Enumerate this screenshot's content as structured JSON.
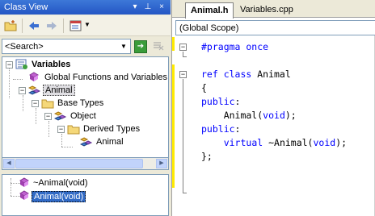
{
  "class_view": {
    "title": "Class View",
    "title_buttons": [
      "▾",
      "⊥",
      "×"
    ],
    "search": {
      "placeholder": "<Search>",
      "value": "<Search>"
    },
    "tree": [
      {
        "label": "Variables",
        "bold": true,
        "icon": "project-icon",
        "expander": "-"
      },
      {
        "label": "Global Functions and Variables",
        "icon": "global-functions-icon"
      },
      {
        "label": "Animal",
        "icon": "class-icon",
        "expander": "-",
        "selected_outline": true
      },
      {
        "label": "Base Types",
        "icon": "folder-icon",
        "expander": "-"
      },
      {
        "label": "Object",
        "icon": "class-icon",
        "expander": "-"
      },
      {
        "label": "Derived Types",
        "icon": "folder-icon",
        "expander": "-"
      },
      {
        "label": "Animal",
        "icon": "class-icon"
      }
    ],
    "members": [
      {
        "label": "~Animal(void)",
        "icon": "method-icon"
      },
      {
        "label": "Animal(void)",
        "icon": "method-icon",
        "selected": true
      }
    ]
  },
  "editor": {
    "tabs": [
      {
        "label": "Animal.h",
        "active": true
      },
      {
        "label": "Variables.cpp",
        "active": false
      }
    ],
    "scope": "(Global Scope)",
    "code_lines": [
      [
        {
          "t": "#pragma once",
          "c": "pp"
        }
      ],
      [
        {
          "t": "",
          "c": ""
        }
      ],
      [
        {
          "t": "ref class",
          "c": "kw"
        },
        {
          "t": " Animal",
          "c": ""
        }
      ],
      [
        {
          "t": "{",
          "c": ""
        }
      ],
      [
        {
          "t": "public",
          "c": "kw"
        },
        {
          "t": ":",
          "c": ""
        }
      ],
      [
        {
          "t": "    Animal(",
          "c": ""
        },
        {
          "t": "void",
          "c": "kw"
        },
        {
          "t": ");",
          "c": ""
        }
      ],
      [
        {
          "t": "public",
          "c": "kw"
        },
        {
          "t": ":",
          "c": ""
        }
      ],
      [
        {
          "t": "    ",
          "c": ""
        },
        {
          "t": "virtual",
          "c": "kw"
        },
        {
          "t": " ~Animal(",
          "c": ""
        },
        {
          "t": "void",
          "c": "kw"
        },
        {
          "t": ");",
          "c": ""
        }
      ],
      [
        {
          "t": "};",
          "c": ""
        }
      ]
    ]
  }
}
